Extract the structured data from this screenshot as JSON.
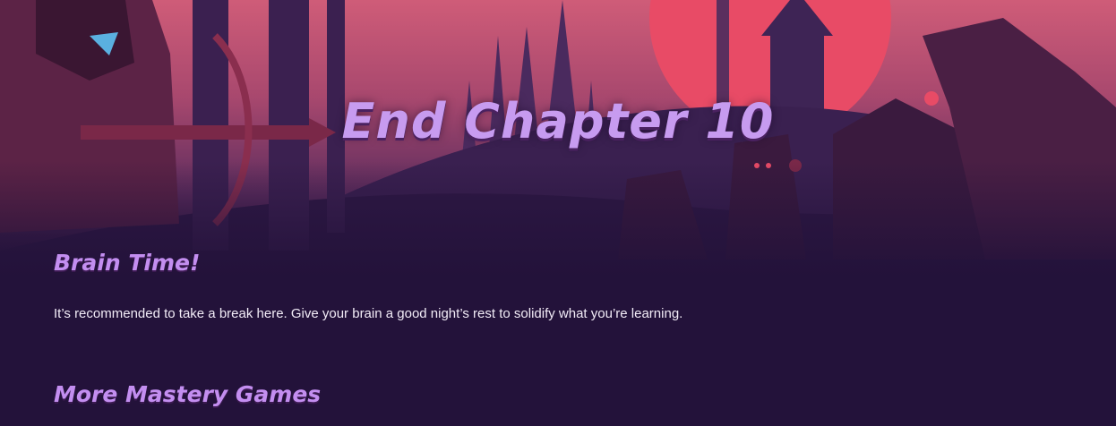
{
  "hero": {
    "title": "End Chapter 10",
    "illustration": "fantasy-forest-hunter-scene"
  },
  "sections": {
    "brain_time": {
      "heading": "Brain Time!",
      "body": "It’s recommended to take a break here. Give your brain a good night’s rest to solidify what you’re learning."
    },
    "mastery": {
      "heading": "More Mastery Games"
    }
  },
  "colors": {
    "background": "#23123a",
    "heading": "#c38ef0",
    "title": "#c79bf0",
    "sky": "#c9516b",
    "moon": "#e84b66"
  }
}
